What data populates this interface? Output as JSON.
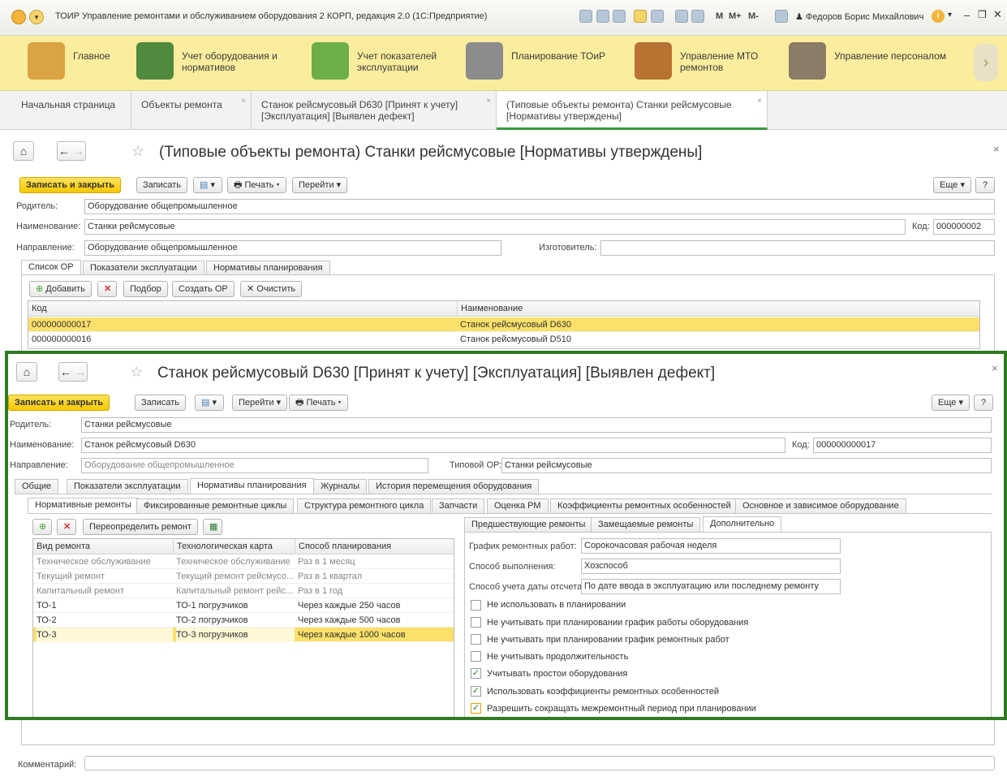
{
  "window": {
    "title": "ТОИР Управление ремонтами и обслуживанием оборудования 2 КОРП, редакция 2.0 (1С:Предприятие)",
    "user": "Федоров Борис Михайлович",
    "toolbar_text": [
      "M",
      "M+",
      "M-"
    ]
  },
  "sections": [
    {
      "label": "Главное",
      "icon": "desk-icon",
      "color": "#d9a441"
    },
    {
      "label": "Учет оборудования и\nнормативов",
      "icon": "equipment-icon",
      "color": "#4f8a3e"
    },
    {
      "label": "Учет показателей\nэксплуатации",
      "icon": "gauge-icon",
      "color": "#6cae48"
    },
    {
      "label": "Планирование ТОиР",
      "icon": "compass-icon",
      "color": "#8c8c8c"
    },
    {
      "label": "Управление МТО\nремонтов",
      "icon": "boxes-icon",
      "color": "#b87332"
    },
    {
      "label": "Управление персоналом",
      "icon": "person-icon",
      "color": "#8a7c66"
    }
  ],
  "open_tabs": [
    {
      "label": "Начальная страница"
    },
    {
      "label": "Объекты ремонта"
    },
    {
      "label": "Станок рейсмусовый D630 [Принят к учету]\n[Эксплуатация] [Выявлен дефект]"
    },
    {
      "label": "(Типовые объекты ремонта) Станки рейсмусовые\n[Нормативы утверждены]"
    }
  ],
  "form1": {
    "title": "(Типовые объекты ремонта) Станки рейсмусовые [Нормативы утверждены]",
    "buttons": {
      "save_close": "Записать и закрыть",
      "save": "Записать",
      "print": "Печать",
      "goto": "Перейти",
      "more": "Еще",
      "help": "?"
    },
    "fields": {
      "parent_label": "Родитель:",
      "parent": "Оборудование общепромышленное",
      "name_label": "Наименование:",
      "name": "Станки рейсмусовые",
      "code_label": "Код:",
      "code": "000000002",
      "direction_label": "Направление:",
      "direction": "Оборудование общепромышленное",
      "maker_label": "Изготовитель:",
      "maker": ""
    },
    "tabs": [
      "Список ОР",
      "Показатели эксплуатации",
      "Нормативы планирования"
    ],
    "list_buttons": {
      "add": "Добавить",
      "pick": "Подбор",
      "create": "Создать ОР",
      "clear": "Очистить"
    },
    "columns": [
      "Код",
      "Наименование"
    ],
    "rows": [
      [
        "000000000017",
        "Станок рейсмусовый D630"
      ],
      [
        "000000000016",
        "Станок рейсмусовый D510"
      ]
    ],
    "comment_label": "Комментарий:"
  },
  "form2": {
    "title": "Станок рейсмусовый D630 [Принят к учету] [Эксплуатация] [Выявлен дефект]",
    "buttons": {
      "save_close": "Записать и закрыть",
      "save": "Записать",
      "goto": "Перейти",
      "print": "Печать",
      "more": "Еще",
      "help": "?"
    },
    "fields": {
      "parent_label": "Родитель:",
      "parent": "Станки рейсмусовые",
      "name_label": "Наименование:",
      "name": "Станок рейсмусовый D630",
      "code_label": "Код:",
      "code": "000000000017",
      "direction_label": "Направление:",
      "direction": "Оборудование общепромышленное",
      "typical_label": "Типовой ОР:",
      "typical": "Станки рейсмусовые"
    },
    "tabs": [
      "Общие",
      "Показатели эксплуатации",
      "Нормативы планирования",
      "Журналы",
      "История перемещения оборудования"
    ],
    "subtabs": [
      "Нормативные ремонты",
      "Фиксированные ремонтные циклы",
      "Структура ремонтного цикла",
      "Запчасти",
      "Оценка РМ",
      "Коэффициенты ремонтных особенностей",
      "Основное и зависимое оборудование"
    ],
    "left_buttons": {
      "redefine": "Переопределить ремонт"
    },
    "columns": [
      "Вид ремонта",
      "Технологическая карта",
      "Способ планирования"
    ],
    "rows": [
      {
        "type": "Техническое обслуживание",
        "card": "Техническое обслуживание",
        "plan": "Раз в 1 месяц",
        "dim": true,
        "sel": false
      },
      {
        "type": "Текущий ремонт",
        "card": "Текущий ремонт рейсмусо...",
        "plan": "Раз в 1 квартал",
        "dim": true,
        "sel": false
      },
      {
        "type": "Капитальный ремонт",
        "card": "Капитальный ремонт рейс...",
        "plan": "Раз в 1 год",
        "dim": true,
        "sel": false
      },
      {
        "type": "ТО-1",
        "card": "ТО-1 погрузчиков",
        "plan": "Через каждые 250 часов",
        "dim": false,
        "sel": false
      },
      {
        "type": "ТО-2",
        "card": "ТО-2 погрузчиков",
        "plan": "Через каждые 500 часов",
        "dim": false,
        "sel": false
      },
      {
        "type": "ТО-3",
        "card": "ТО-3 погрузчиков",
        "plan": "Через каждые 1000 часов",
        "dim": false,
        "sel": true
      }
    ],
    "right_tabs": [
      "Предшествующие ремонты",
      "Замещаемые ремонты",
      "Дополнительно"
    ],
    "right_fields": {
      "schedule_label": "График ремонтных работ:",
      "schedule": "Сорокочасовая рабочая неделя",
      "method_label": "Способ выполнения:",
      "method": "Хозспособ",
      "date_label": "Способ учета даты отсчета:",
      "date": "По дате ввода в эксплуатацию или последнему ремонту"
    },
    "checks": [
      {
        "label": "Не использовать в планировании",
        "checked": false
      },
      {
        "label": "Не учитывать при планировании график работы оборудования",
        "checked": false
      },
      {
        "label": "Не учитывать при планировании график ремонтных работ",
        "checked": false
      },
      {
        "label": "Не учитывать продолжительность",
        "checked": false
      },
      {
        "label": "Учитывать простои оборудования",
        "checked": true
      },
      {
        "label": "Использовать коэффициенты ремонтных особенностей",
        "checked": true
      },
      {
        "label": "Разрешить сокращать межремонтный период при планировании",
        "checked": true
      }
    ]
  }
}
